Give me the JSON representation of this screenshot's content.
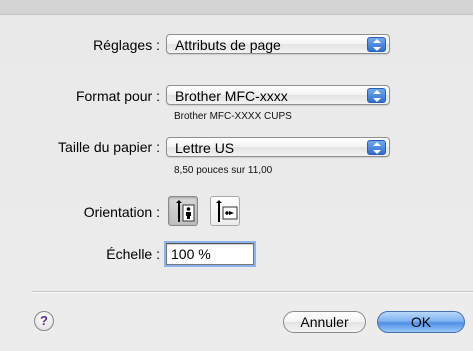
{
  "dialog": {
    "settings": {
      "label": "Réglages :",
      "value": "Attributs de page"
    },
    "format": {
      "label": "Format pour :",
      "value": "Brother MFC-xxxx",
      "subtitle": "Brother MFC-XXXX CUPS"
    },
    "paper": {
      "label": "Taille du papier :",
      "value": "Lettre US",
      "subtitle": "8,50 pouces sur 11,00"
    },
    "orientation": {
      "label": "Orientation :",
      "selected": "portrait",
      "options": [
        "portrait",
        "landscape"
      ]
    },
    "scale": {
      "label": "Échelle :",
      "value": "100 %"
    },
    "help_glyph": "?",
    "buttons": {
      "cancel": "Annuler",
      "ok": "OK"
    }
  },
  "colors": {
    "accent": "#4e8fe6",
    "popup_arrow": "#3a7ee0",
    "focus_ring": "#8cb4ea"
  },
  "icons": [
    "popup-arrows-icon",
    "portrait-orientation-icon",
    "landscape-orientation-icon",
    "help-icon"
  ]
}
